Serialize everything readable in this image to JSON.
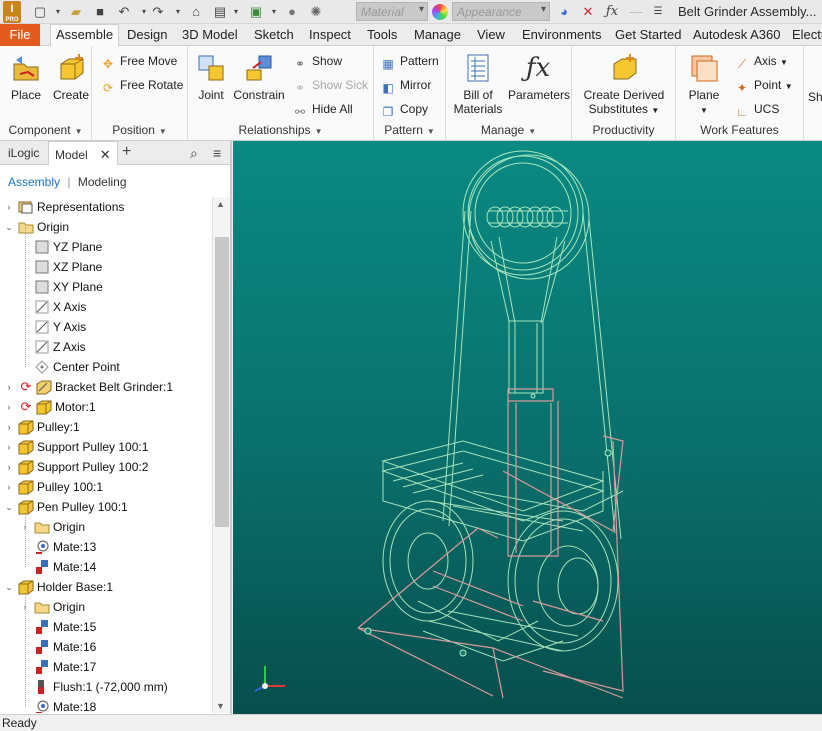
{
  "app": {
    "title": "Belt Grinder Assembly...",
    "logo_text": "I",
    "logo_sub": "PRO"
  },
  "qat": {
    "material": "Material",
    "appearance": "Appearance"
  },
  "tabs": [
    "File",
    "Assemble",
    "Design",
    "3D Model",
    "Sketch",
    "Inspect",
    "Tools",
    "Manage",
    "View",
    "Environments",
    "Get Started",
    "Autodesk A360",
    "Electr"
  ],
  "ribbon": {
    "component": {
      "label": "Component",
      "place": "Place",
      "create": "Create"
    },
    "position": {
      "label": "Position",
      "free_move": "Free Move",
      "free_rotate": "Free Rotate"
    },
    "relationships": {
      "label": "Relationships",
      "joint": "Joint",
      "constrain": "Constrain",
      "show": "Show",
      "show_sick": "Show Sick",
      "hide_all": "Hide All"
    },
    "pattern": {
      "label": "Pattern",
      "pattern": "Pattern",
      "mirror": "Mirror",
      "copy": "Copy"
    },
    "manage": {
      "label": "Manage",
      "bom_line1": "Bill of",
      "bom_line2": "Materials",
      "parameters": "Parameters"
    },
    "productivity": {
      "label": "Productivity",
      "line1": "Create Derived",
      "line2": "Substitutes"
    },
    "work_features": {
      "label": "Work Features",
      "plane": "Plane",
      "axis": "Axis",
      "point": "Point",
      "ucs": "UCS"
    },
    "next": {
      "label": "Sh"
    }
  },
  "browser": {
    "tab_ilogic": "iLogic",
    "tab_model": "Model",
    "view_assembly": "Assembly",
    "view_sep": "|",
    "view_modeling": "Modeling",
    "items": [
      {
        "label": "Representations"
      },
      {
        "label": "Origin"
      },
      {
        "label": "YZ Plane"
      },
      {
        "label": "XZ Plane"
      },
      {
        "label": "XY Plane"
      },
      {
        "label": "X Axis"
      },
      {
        "label": "Y Axis"
      },
      {
        "label": "Z Axis"
      },
      {
        "label": "Center Point"
      },
      {
        "label": "Bracket Belt Grinder:1"
      },
      {
        "label": "Motor:1"
      },
      {
        "label": "Pulley:1"
      },
      {
        "label": "Support Pulley 100:1"
      },
      {
        "label": "Support Pulley 100:2"
      },
      {
        "label": "Pulley 100:1"
      },
      {
        "label": "Pen Pulley 100:1"
      },
      {
        "label": "Origin"
      },
      {
        "label": "Mate:13"
      },
      {
        "label": "Mate:14"
      },
      {
        "label": "Holder Base:1"
      },
      {
        "label": "Origin"
      },
      {
        "label": "Mate:15"
      },
      {
        "label": "Mate:16"
      },
      {
        "label": "Mate:17"
      },
      {
        "label": "Flush:1 (-72,000 mm)"
      },
      {
        "label": "Mate:18"
      }
    ]
  },
  "status": {
    "text": "Ready"
  }
}
